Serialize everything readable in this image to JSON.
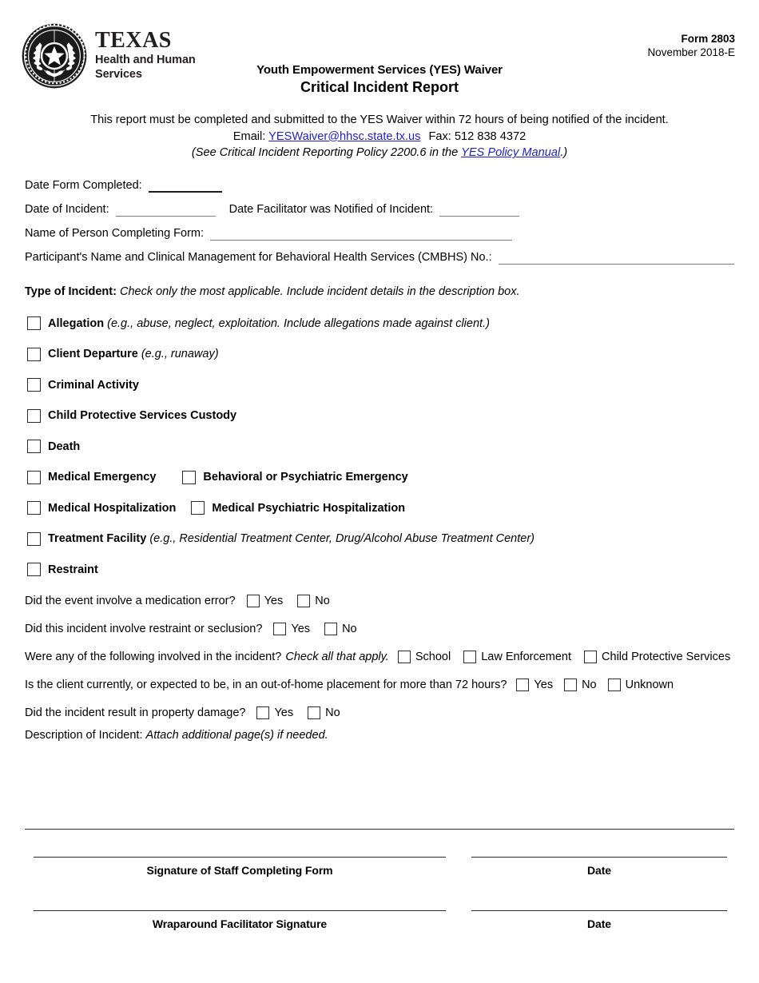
{
  "header": {
    "logo": {
      "seal_icon": "texas-state-seal-icon",
      "texas": "TEXAS",
      "sub_line1": "Health and Human",
      "sub_line2": "Services"
    },
    "form_number": "Form 2803",
    "form_date": "November 2018-E",
    "title_line1": "Youth Empowerment Services (YES) Waiver",
    "title_line2": "Critical Incident Report"
  },
  "intro": {
    "line1": "This report must be completed and submitted to the YES Waiver within 72 hours of being notified of the incident.",
    "line2_prefix": "Email:",
    "email": "YESWaiver@hhsc.state.tx.us",
    "line2_fax": "Fax: 512 838 4372",
    "line3_italic": "(See Critical Incident Reporting",
    "line3_mid": " Policy 2200.6 in the ",
    "line3_link": "YES Policy Manual",
    "line3_suffix": ".)",
    "link_color": "#2020cc"
  },
  "fields": {
    "date_form_completed_label": "Date Form Completed:",
    "date_form_completed_value": "",
    "date_of_incident_label": "Date of Incident:",
    "date_of_incident_value": "",
    "date_facilitator_notified_label": "Date Facilitator was Notified of Incident:",
    "date_facilitator_notified_value": "",
    "name_person_completing_label": "Name of Person Completing Form:",
    "name_person_completing_value": "",
    "participant_label": "Participant's Name and Clinical Management for Behavioral Health Services (CMBHS) No.:",
    "participant_value": ""
  },
  "type_of_incident": {
    "heading_bold": "Type of Incident:",
    "heading_italic": "Check only the most applicable. Include incident details in the description box.",
    "rows": [
      {
        "items": [
          {
            "label": "Allegation",
            "note": "(e.g., abuse, neglect, exploitation. Include allegations made against client.)",
            "checked": false
          }
        ]
      },
      {
        "items": [
          {
            "label": "Client Departure",
            "note": "(e.g., runaway)",
            "checked": false
          }
        ]
      },
      {
        "items": [
          {
            "label": "Criminal Activity",
            "note": "",
            "checked": false
          }
        ]
      },
      {
        "items": [
          {
            "label": "Child Protective Services Custody",
            "note": "",
            "checked": false
          }
        ]
      },
      {
        "items": [
          {
            "label": "Death",
            "note": "",
            "checked": false
          }
        ]
      },
      {
        "items": [
          {
            "label": "Medical Emergency",
            "note": "",
            "checked": false
          },
          {
            "label": "Behavioral or Psychiatric Emergency",
            "note": "",
            "checked": false
          }
        ]
      },
      {
        "items": [
          {
            "label": "Medical Hospitalization",
            "note": "",
            "checked": false
          },
          {
            "label": "Medical Psychiatric Hospitalization",
            "note": "",
            "checked": false
          }
        ]
      },
      {
        "items": [
          {
            "label": "Treatment Facility",
            "note": "(e.g., Residential Treatment Center, Drug/Alcohol Abuse Treatment Center)",
            "checked": false
          }
        ]
      },
      {
        "items": [
          {
            "label": "Restraint",
            "note": "",
            "checked": false
          }
        ]
      }
    ]
  },
  "questions": [
    {
      "text": "Did the event involve a medication error?",
      "italic": "",
      "options": [
        {
          "label": "Yes",
          "checked": false
        },
        {
          "label": "No",
          "checked": false
        }
      ]
    },
    {
      "text": "Did this incident involve restraint or seclusion?",
      "italic": "",
      "options": [
        {
          "label": "Yes",
          "checked": false
        },
        {
          "label": "No",
          "checked": false
        }
      ]
    },
    {
      "text": "Were any of the following involved in the incident?",
      "italic": "Check all that apply.",
      "options": [
        {
          "label": "School",
          "checked": false
        },
        {
          "label": "Law Enforcement",
          "checked": false
        },
        {
          "label": "Child Protective Services",
          "checked": false
        }
      ]
    },
    {
      "text": "Is the client currently, or expected to be, in an out-of-home placement for more than 72 hours?",
      "italic": "",
      "options": [
        {
          "label": "Yes",
          "checked": false
        },
        {
          "label": "No",
          "checked": false
        },
        {
          "label": "Unknown",
          "checked": false
        }
      ]
    },
    {
      "text": "Did the incident result in property damage?",
      "italic": "",
      "options": [
        {
          "label": "Yes",
          "checked": false
        },
        {
          "label": "No",
          "checked": false
        }
      ]
    }
  ],
  "description": {
    "label": "Description of Incident:",
    "italic": "Attach additional page(s) if needed.",
    "value": ""
  },
  "signatures": [
    {
      "signature_caption": "Signature of Staff Completing Form",
      "signature_value": "",
      "date_caption": "Date",
      "date_value": ""
    },
    {
      "signature_caption": "Wraparound Facilitator Signature",
      "signature_value": "",
      "date_caption": "Date",
      "date_value": ""
    }
  ]
}
